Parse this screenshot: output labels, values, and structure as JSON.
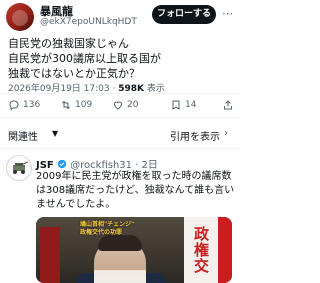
{
  "post": {
    "author_name": "暴風龍",
    "handle": "@ekX7epoUNLkqHDT",
    "follow_label": "フォローする",
    "text_lines": [
      "自民党の独裁国家じゃん",
      "自民党が300議席以上取る国が",
      "独裁ではないとか正気か？"
    ],
    "timestamp": "2026年09月19日 17:03 · ",
    "views_count": "598K",
    "views_label": " 表示"
  },
  "actions": {
    "replies": "136",
    "reposts": "109",
    "likes": "20",
    "bookmarks": "14"
  },
  "related": {
    "relevance_label": "関連性",
    "quotes_label": "引用を表示"
  },
  "reply": {
    "author_name": "JSF",
    "handle": "@rockfish31",
    "time": "· 2日",
    "text": "2009年に民主党が政権を取った時の議席数は308議席だったけど、独裁なんて誰も言いませんでしたよ。",
    "image_caption": "鳩山首相\"チェンジ\"\n政権交代の功罪",
    "image_banner": "政権交"
  },
  "colors": {
    "text_primary": "#0f1419",
    "text_secondary": "#536471",
    "follow_bg": "#0f1419",
    "verified_blue": "#1d9bf0",
    "divider": "#eff3f4"
  },
  "icons": {
    "more": "more-dots-icon",
    "reply": "reply-icon",
    "repost": "repost-icon",
    "like": "like-icon",
    "bookmark": "bookmark-icon",
    "share": "share-icon",
    "verified": "verified-badge-icon"
  }
}
